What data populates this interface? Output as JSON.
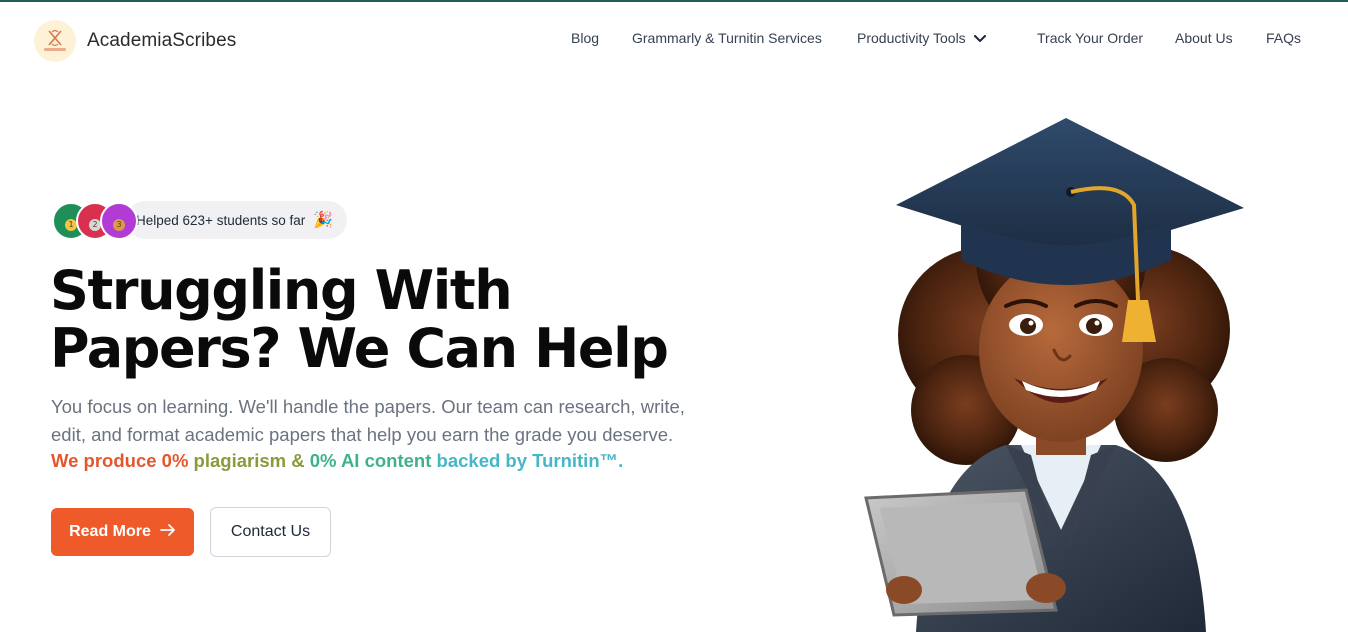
{
  "brand": {
    "name": "AcademiaScribes",
    "logo_icon": "scribes-logo-icon",
    "logo_bg": "#fdf2d6",
    "logo_accent": "#d9774b"
  },
  "colors": {
    "top_strip": "#1f5f5b",
    "primary": "#ef5a2b",
    "headline": "#0a0a0a",
    "muted": "#6b7280"
  },
  "nav": {
    "items": [
      {
        "label": "Blog"
      },
      {
        "label": "Grammarly & Turnitin Services"
      },
      {
        "label": "Productivity Tools"
      },
      {
        "label": "Track Your Order"
      },
      {
        "label": "About Us"
      },
      {
        "label": "FAQs"
      }
    ],
    "dropdown_icon": "chevron-down-icon"
  },
  "hero": {
    "badge": {
      "text": "Helped 623+ students so far",
      "emoji": "🎉",
      "avatars": [
        {
          "color": "#1f8f5a",
          "medal": "1"
        },
        {
          "color": "#d9304f",
          "medal": "2"
        },
        {
          "color": "#b23bd6",
          "medal": "3"
        }
      ]
    },
    "headline_line1": "Struggling With",
    "headline_line2": "Papers? We Can Help",
    "subtext": "You focus on learning. We'll handle the papers. Our team can research, write, edit, and format academic papers that help you earn the grade you deserve.",
    "highlight": {
      "part1": "We produce 0%",
      "part2": " plagiarism &",
      "part3": " 0% AI content",
      "part4": " backed by Turnitin™."
    },
    "primary_button": "Read More",
    "secondary_button": "Contact Us"
  }
}
